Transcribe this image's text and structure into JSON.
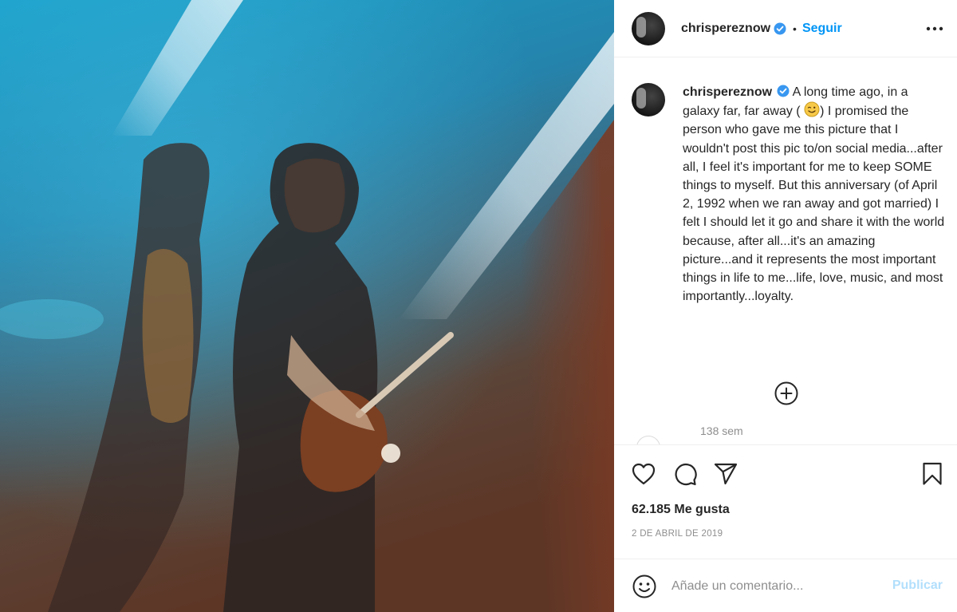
{
  "post": {
    "username": "chrispereznow",
    "follow_label": "Seguir",
    "separator": "•",
    "caption_part1": "A long time ago, in a galaxy far, far away (",
    "caption_part2": ") I promised the person who gave me this picture that I wouldn't post this pic to/on social media...after all, I feel it's important for me to keep SOME things to myself. But this anniversary (of April 2, 1992 when we ran away and got married) I felt I should let it go and share it with the world because, after all...it's an amazing picture...and it represents the most important things in life to me...life, love, music, and most importantly...loyalty.",
    "age": "138 sem",
    "likes": "62.185 Me gusta",
    "date": "2 DE ABRIL DE 2019"
  },
  "comment_box": {
    "placeholder": "Añade un comentario...",
    "publish_label": "Publicar"
  },
  "icons": {
    "verified": "verified-badge-icon",
    "more": "more-options-icon",
    "emoji": "winking-face-emoji",
    "load_more": "plus-circle-icon",
    "like": "heart-icon",
    "comment": "comment-bubble-icon",
    "share": "send-icon",
    "save": "bookmark-icon",
    "smiley": "smiley-icon"
  },
  "colors": {
    "link_blue": "#0095f6",
    "publish_disabled": "#b2dffc",
    "muted_text": "#8e8e8e",
    "verified_blue": "#3897f0"
  }
}
